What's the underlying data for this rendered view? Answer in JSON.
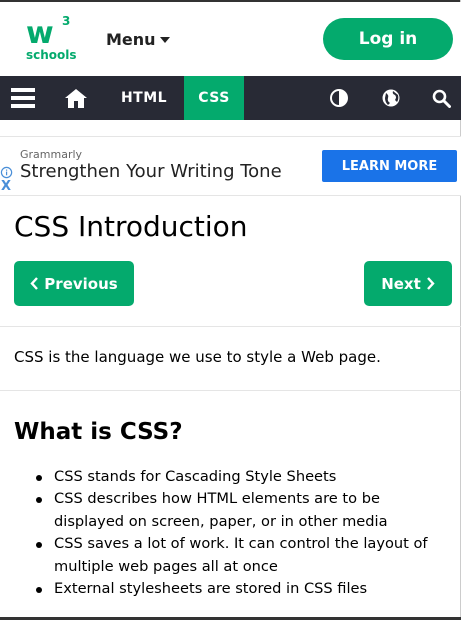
{
  "header": {
    "logo_text": "w",
    "logo_superscript": "3",
    "logo_subtext": "schools",
    "menu_label": "Menu",
    "login_label": "Log in"
  },
  "nav": {
    "items": [
      {
        "icon": "hamburger-menu-icon"
      },
      {
        "icon": "home-icon"
      },
      {
        "label": "HTML"
      },
      {
        "label": "CSS",
        "active": true
      },
      {
        "icon": "contrast-icon"
      },
      {
        "icon": "globe-icon"
      },
      {
        "icon": "search-icon"
      }
    ]
  },
  "ad": {
    "brand": "Grammarly",
    "headline": "Strengthen Your Writing Tone",
    "cta": "LEARN MORE",
    "close": "X"
  },
  "main": {
    "title": "CSS Introduction",
    "prev_label": "Previous",
    "next_label": "Next",
    "intro": "CSS is the language we use to style a Web page.",
    "section_title": "What is CSS?",
    "bullets": [
      "CSS stands for Cascading Style Sheets",
      "CSS describes how HTML elements are to be displayed on screen, paper, or in other media",
      "CSS saves a lot of work. It can control the layout of multiple web pages all at once",
      "External stylesheets are stored in CSS files"
    ]
  },
  "colors": {
    "brand_green": "#04aa6d",
    "nav_dark": "#282a35",
    "ad_blue": "#1a73e8"
  }
}
